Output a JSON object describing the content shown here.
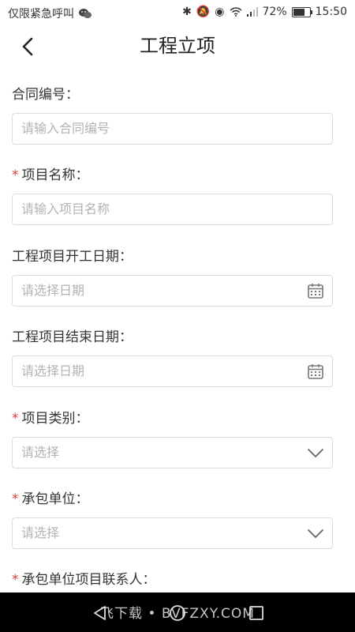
{
  "status_bar": {
    "carrier": "仅限紧急呼叫",
    "battery": "72%",
    "time": "15:50",
    "battery_level": 0.72
  },
  "header": {
    "title": "工程立项"
  },
  "form": {
    "fields": [
      {
        "label": "合同编号：",
        "required": false,
        "placeholder": "请输入合同编号",
        "type": "text"
      },
      {
        "label": "项目名称：",
        "required": true,
        "placeholder": "请输入项目名称",
        "type": "text"
      },
      {
        "label": "工程项目开工日期：",
        "required": false,
        "placeholder": "请选择日期",
        "type": "date",
        "icon": "calendar-icon"
      },
      {
        "label": "工程项目结束日期：",
        "required": false,
        "placeholder": "请选择日期",
        "type": "date",
        "icon": "calendar-icon"
      },
      {
        "label": "项目类别：",
        "required": true,
        "placeholder": "请选择",
        "type": "select",
        "icon": "chevron-down-icon"
      },
      {
        "label": "承包单位：",
        "required": true,
        "placeholder": "请选择",
        "type": "select",
        "icon": "chevron-down-icon"
      },
      {
        "label": "承包单位项目联系人：",
        "required": true
      }
    ],
    "required_mark": "*"
  },
  "watermark": "飞下载 • BVFZXY.COM"
}
